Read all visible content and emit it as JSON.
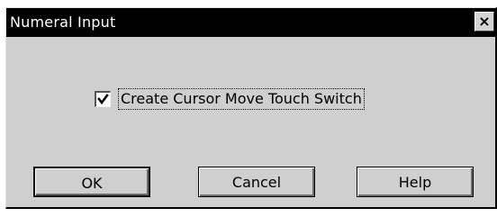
{
  "window": {
    "title": "Numeral Input",
    "close_glyph": "×",
    "close_icon": "close-icon"
  },
  "options": {
    "create_cursor_switch": {
      "label": "Create Cursor Move Touch Switch",
      "checked": true
    }
  },
  "buttons": {
    "ok": "OK",
    "cancel": "Cancel",
    "help": "Help"
  }
}
